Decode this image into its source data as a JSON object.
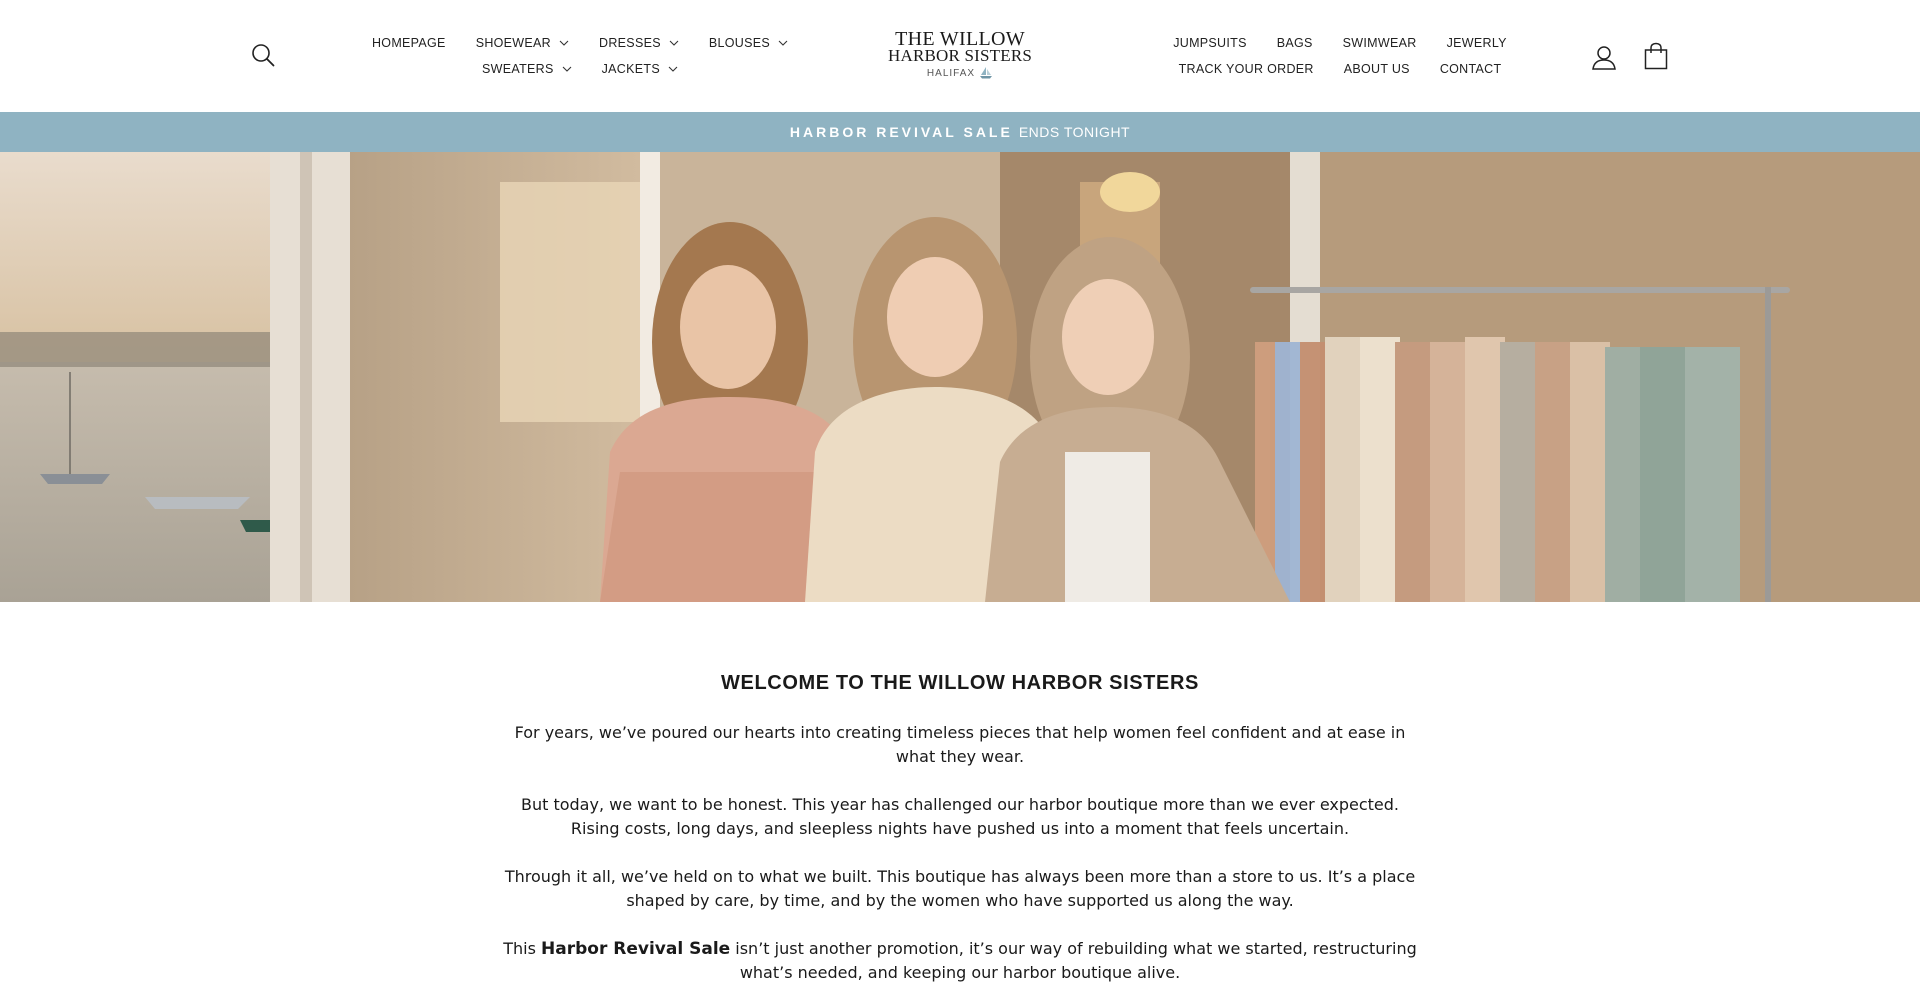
{
  "header": {
    "logo": {
      "line1": "THE WILLOW",
      "line2": "HARBOR SISTERS",
      "line3": "HALIFAX"
    },
    "nav_left": {
      "row1": [
        {
          "label": "HOMEPAGE",
          "dropdown": false
        },
        {
          "label": "SHOEWEAR",
          "dropdown": true
        },
        {
          "label": "DRESSES",
          "dropdown": true
        },
        {
          "label": "BLOUSES",
          "dropdown": true
        }
      ],
      "row2": [
        {
          "label": "SWEATERS",
          "dropdown": true
        },
        {
          "label": "JACKETS",
          "dropdown": true
        }
      ]
    },
    "nav_right": {
      "row1": [
        {
          "label": "JUMPSUITS"
        },
        {
          "label": "BAGS"
        },
        {
          "label": "SWIMWEAR"
        },
        {
          "label": "JEWERLY"
        }
      ],
      "row2": [
        {
          "label": "TRACK YOUR ORDER"
        },
        {
          "label": "ABOUT US"
        },
        {
          "label": "CONTACT"
        }
      ]
    },
    "icons": {
      "search": "search-icon",
      "account": "user-icon",
      "cart": "shopping-bag-icon"
    }
  },
  "announcement": {
    "strong": "HARBOR REVIVAL SALE",
    "text": "ENDS TONIGHT",
    "background": "#8fb3c2"
  },
  "hero": {
    "image": "three-women-smiling-in-boutique-doorway-with-harbor-view-and-clothing-rack"
  },
  "main": {
    "heading": "WELCOME TO THE WILLOW HARBOR SISTERS",
    "paragraphs": [
      "For years, we’ve poured our hearts into creating timeless pieces that help women feel confident and at ease in what they wear.",
      "But today, we want to be honest. This year has challenged our harbor boutique more than we ever expected. Rising costs, long days, and sleepless nights have pushed us into a moment that feels uncertain.",
      "Through it all, we’ve held on to what we built. This boutique has always been more than a store to us. It’s a place shaped by care, by time, and by the women who have supported us along the way."
    ],
    "last_paragraph": {
      "before": "This ",
      "bold": "Harbor Revival Sale",
      "after": " isn’t just another promotion, it’s our way of rebuilding what we started, restructuring what’s needed, and keeping our harbor boutique alive."
    }
  }
}
